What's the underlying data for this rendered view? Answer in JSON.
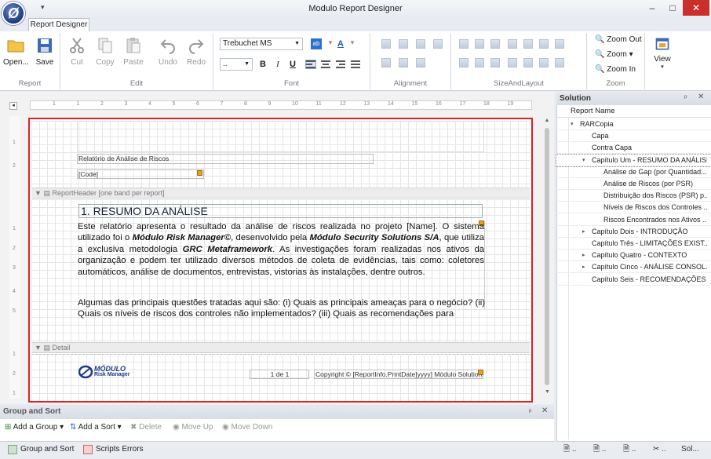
{
  "window": {
    "title": "Modulo Report Designer",
    "minimize": "–",
    "maximize": "□",
    "close": "✕"
  },
  "app_logo_glyph": "Ø",
  "qat_glyph": "▾",
  "ribbon": {
    "tab": "Report Designer",
    "groups": {
      "report": {
        "label": "Report",
        "open": "Open...",
        "save": "Save"
      },
      "edit": {
        "label": "Edit",
        "cut": "Cut",
        "copy": "Copy",
        "paste": "Paste",
        "undo": "Undo",
        "redo": "Redo"
      },
      "font": {
        "label": "Font",
        "family": "Trebuchet MS",
        "size": "..",
        "bold": "B",
        "italic": "I",
        "underline": "U"
      },
      "alignment": {
        "label": "Alignment"
      },
      "sizeandlayout": {
        "label": "SizeAndLayout"
      },
      "zoom": {
        "label": "Zoom",
        "zoom_out": "Zoom Out",
        "zoom": "Zoom",
        "zoom_in": "Zoom In"
      },
      "view": {
        "label": "View"
      }
    }
  },
  "ruler": {
    "marks": [
      "1",
      "1",
      "2",
      "3",
      "4",
      "5",
      "6",
      "7",
      "8",
      "9",
      "10",
      "11",
      "12",
      "13",
      "14",
      "15",
      "16",
      "17",
      "18",
      "19"
    ],
    "vmarks": [
      "1",
      "2",
      "1",
      "2",
      "3",
      "4",
      "5",
      "1",
      "2",
      "1"
    ]
  },
  "report": {
    "title_field": "Relatório de Análise de Riscos",
    "code_field": "[Code]",
    "header_band": "ReportHeader [one band per report]",
    "heading": "1. RESUMO DA ANÁLISE",
    "para1_a": "Este relatório apresenta o resultado da análise de riscos realizada no projeto [Name]. O sistema utilizado foi o ",
    "para1_b": "Módulo Risk Manager©",
    "para1_c": ", desenvolvido pela ",
    "para1_d": "Módulo Security Solutions S/A",
    "para1_e": ", que utiliza a exclusiva metodologia ",
    "para1_f": "GRC Metaframework",
    "para1_g": ". As investigações foram realizadas nos ativos da organização e podem ter utilizado diversos métodos de coleta de evidências, tais como: coletores automáticos, análise de documentos, entrevistas, vistorias às instalações, dentre outros.",
    "para2": "Algumas das principais questões tratadas aqui são: (i) Quais as principais ameaças para o negócio? (ii) Quais os níveis de riscos dos controles não implementados? (iii) Quais as recomendações para",
    "detail_band": "Detail",
    "logo_top": "MÓDULO",
    "logo_bottom": "Risk Manager",
    "page_field": "1 de 1",
    "copyright_field": "Copyright © [ReportInfo.PrintDate]yyyy] Módulo Solutions"
  },
  "group_sort": {
    "title": "Group and Sort",
    "add_group": "Add a Group ▾",
    "add_sort": "Add a Sort ▾",
    "delete": "Delete",
    "move_up": "Move Up",
    "move_down": "Move Down"
  },
  "bottom_tabs": {
    "group_sort": "Group and Sort",
    "scripts_errors": "Scripts Errors"
  },
  "solution": {
    "title": "Solution",
    "pin": "ᵖ",
    "close": "✕",
    "column": "Report Name",
    "items": [
      {
        "label": "RARCopia"
      },
      {
        "label": "Capa"
      },
      {
        "label": "Contra Capa"
      },
      {
        "label": "Capítulo Um - RESUMO DA ANÁLISE"
      },
      {
        "label": "Análise de Gap (por Quantidad..."
      },
      {
        "label": "Análise de Riscos (por PSR)"
      },
      {
        "label": "Distribuição dos Riscos (PSR) p..."
      },
      {
        "label": "Níveis de Riscos dos Controles ..."
      },
      {
        "label": "Riscos Encontrados nos Ativos ..."
      },
      {
        "label": "Capítulo Dois - INTRODUÇÃO"
      },
      {
        "label": "Capítulo Três - LIMITAÇÕES EXIST..."
      },
      {
        "label": "Capítulo Quatro - CONTEXTO"
      },
      {
        "label": "Capítulo Cinco - ANÁLISE CONSOL..."
      },
      {
        "label": "Capítulo Seis - RECOMENDAÇÕES"
      }
    ],
    "tabs": [
      "..",
      "..",
      "..",
      "..",
      "Sol..."
    ]
  },
  "colors": {
    "accent": "#2b579a",
    "selection_border": "#e02020"
  }
}
